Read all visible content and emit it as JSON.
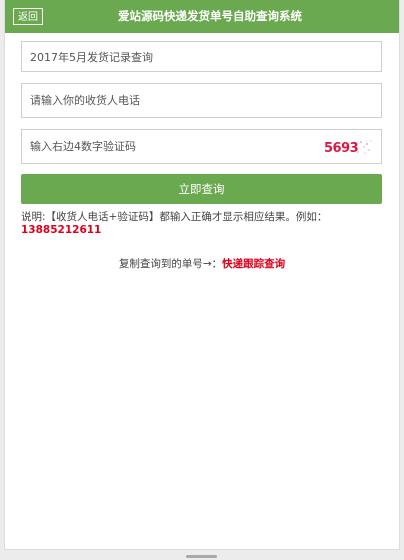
{
  "colors": {
    "green": "#6aa94f",
    "red": "#e0001b",
    "captcha": "#d91a48"
  },
  "header": {
    "back_label": "返回",
    "title": "爱站源码快递发货单号自助查询系统"
  },
  "form": {
    "query_select_value": "2017年5月发货记录查询",
    "phone_placeholder": "请输入你的收货人电话",
    "code_placeholder": "输入右边4数字验证码",
    "captcha_text": "5693",
    "submit_label": "立即查询"
  },
  "note": {
    "text": "说明:【收货人电话+验证码】都输入正确才显示相应结果。例如：",
    "example": "13885212611"
  },
  "copy": {
    "prefix": "复制查询到的单号→：",
    "link": "快递跟踪查询"
  }
}
